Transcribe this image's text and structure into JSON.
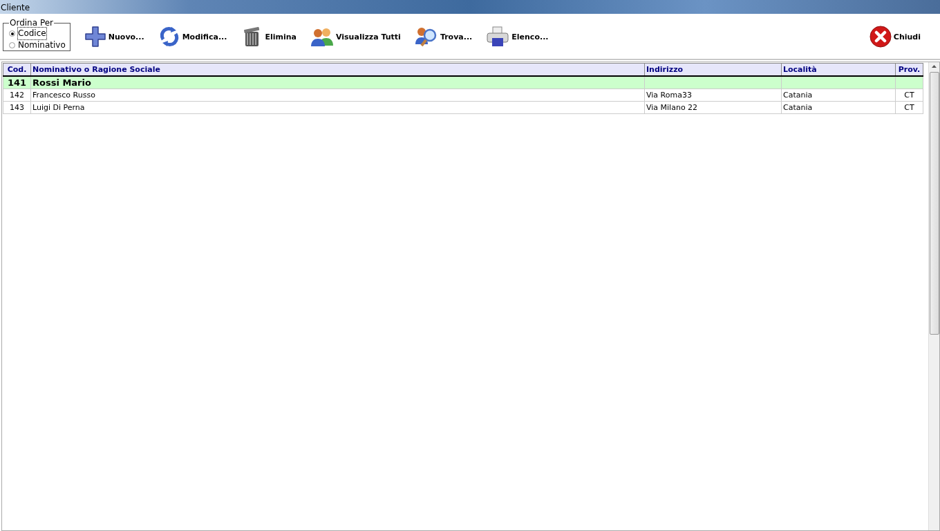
{
  "window": {
    "title": "Cliente"
  },
  "sort_group": {
    "title": "Ordina Per",
    "options": [
      {
        "label": "Codice",
        "selected": true
      },
      {
        "label": "Nominativo",
        "selected": false
      }
    ]
  },
  "toolbar": [
    {
      "label": "Nuovo...",
      "kind": "plus"
    },
    {
      "label": "Modifica...",
      "kind": "refresh"
    },
    {
      "label": "Elimina",
      "kind": "trash"
    },
    {
      "label": "Visualizza Tutti",
      "kind": "users"
    },
    {
      "label": "Trova...",
      "kind": "find"
    },
    {
      "label": "Elenco...",
      "kind": "printer"
    }
  ],
  "close_button": {
    "label": "Chiudi"
  },
  "table": {
    "columns": [
      "Cod.",
      "Nominativo o Ragione Sociale",
      "Indirizzo",
      "Località",
      "Prov."
    ],
    "rows": [
      {
        "cells": [
          "141",
          "Rossi Mario",
          "",
          "",
          ""
        ],
        "selected": true
      },
      {
        "cells": [
          "142",
          "Francesco Russo",
          "Via Roma33",
          "Catania",
          "CT"
        ],
        "selected": false
      },
      {
        "cells": [
          "143",
          "Luigi Di Perna",
          "Via Milano 22",
          "Catania",
          "CT"
        ],
        "selected": false
      }
    ]
  }
}
